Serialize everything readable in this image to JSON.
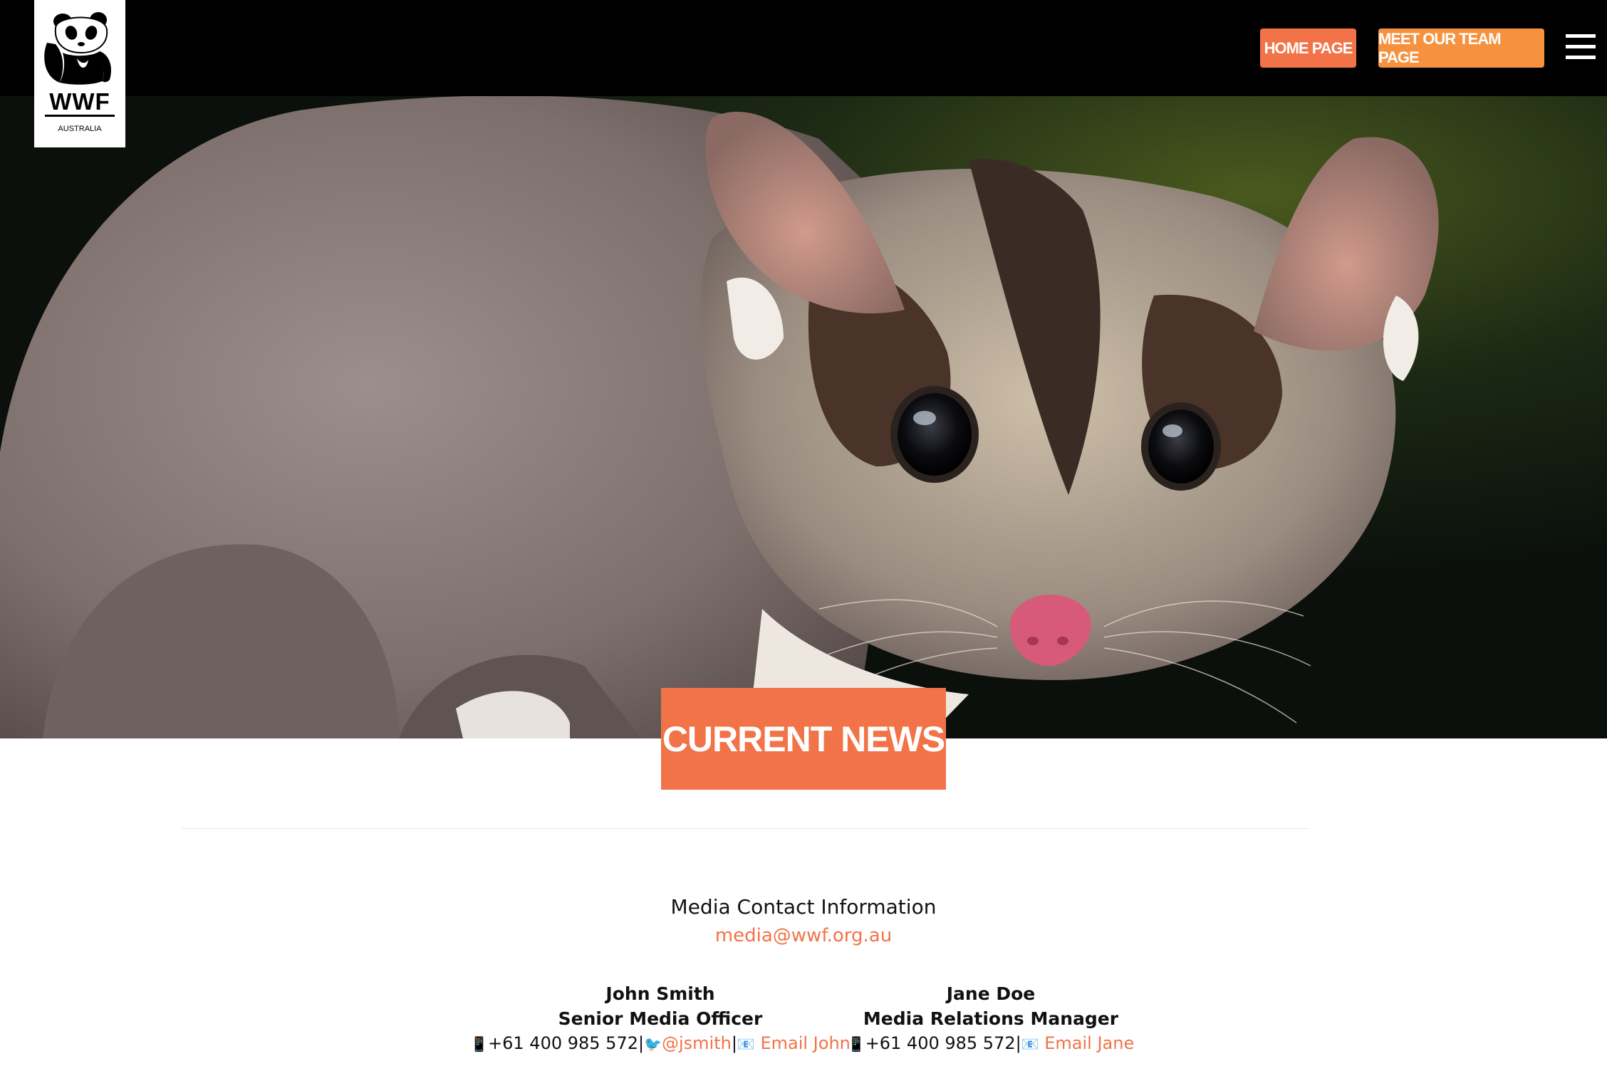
{
  "logo": {
    "text": "WWF",
    "country": "AUSTRALIA"
  },
  "nav": {
    "home_label": "HOME PAGE",
    "team_label": "MEET OUR TEAM PAGE"
  },
  "hero": {
    "badge": "CURRENT NEWS"
  },
  "contact": {
    "title": "Media Contact Information",
    "email": "media@wwf.org.au",
    "people": [
      {
        "name": "John Smith",
        "role": "Senior Media Officer",
        "phone": "+61 400 985 572",
        "twitter": "@jsmith",
        "email_label": "Email John"
      },
      {
        "name": "Jane Doe",
        "role": "Media Relations Manager",
        "phone": "+61 400 985 572",
        "email_label": "Email Jane"
      }
    ]
  },
  "colors": {
    "accent": "#f27348",
    "accent_alt": "#f6923f",
    "topbar": "#000000"
  },
  "icons": {
    "phone": "mobile-phone-icon",
    "twitter": "bird-icon",
    "email": "envelope-icon",
    "menu": "hamburger-icon"
  }
}
